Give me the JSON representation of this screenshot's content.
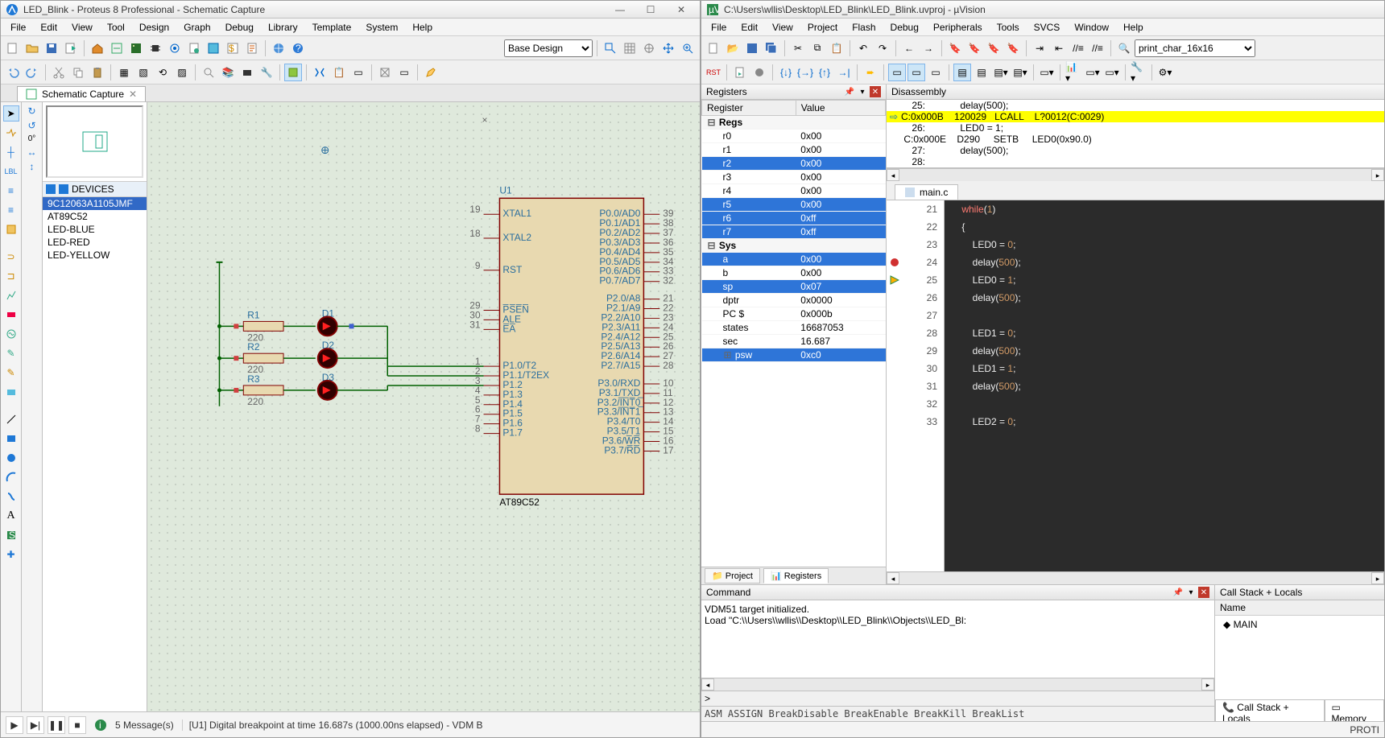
{
  "proteus": {
    "title": "LED_Blink - Proteus 8 Professional - Schematic Capture",
    "menu": [
      "File",
      "Edit",
      "View",
      "Tool",
      "Design",
      "Graph",
      "Debug",
      "Library",
      "Template",
      "System",
      "Help"
    ],
    "designSelector": "Base Design",
    "captureTab": "Schematic Capture",
    "deviceHeader": "DEVICES",
    "deviceList": [
      "9C12063A1105JMF",
      "AT89C52",
      "LED-BLUE",
      "LED-RED",
      "LED-YELLOW"
    ],
    "deviceSelected": 0,
    "statusMessages": "5 Message(s)",
    "statusText": "[U1] Digital breakpoint at time 16.687s (1000.00ns elapsed) - VDM B",
    "rotAngle": "0°",
    "schematic": {
      "u1_ref": "U1",
      "u1_part": "AT89C52",
      "r1": {
        "ref": "R1",
        "val": "220"
      },
      "r2": {
        "ref": "R2",
        "val": "220"
      },
      "r3": {
        "ref": "R3",
        "val": "220"
      },
      "d1": "D1",
      "d2": "D2",
      "d3": "D3",
      "leftPins": [
        {
          "num": "19",
          "name": "XTAL1"
        },
        {
          "num": "18",
          "name": "XTAL2"
        },
        {
          "num": "9",
          "name": "RST"
        },
        {
          "num": "29",
          "name": "P̅S̅E̅N̅"
        },
        {
          "num": "30",
          "name": "ALE"
        },
        {
          "num": "31",
          "name": "E̅A̅"
        },
        {
          "num": "1",
          "name": "P1.0/T2"
        },
        {
          "num": "2",
          "name": "P1.1/T2EX"
        },
        {
          "num": "3",
          "name": "P1.2"
        },
        {
          "num": "4",
          "name": "P1.3"
        },
        {
          "num": "5",
          "name": "P1.4"
        },
        {
          "num": "6",
          "name": "P1.5"
        },
        {
          "num": "7",
          "name": "P1.6"
        },
        {
          "num": "8",
          "name": "P1.7"
        }
      ],
      "rightPins": [
        {
          "num": "39",
          "name": "P0.0/AD0"
        },
        {
          "num": "38",
          "name": "P0.1/AD1"
        },
        {
          "num": "37",
          "name": "P0.2/AD2"
        },
        {
          "num": "36",
          "name": "P0.3/AD3"
        },
        {
          "num": "35",
          "name": "P0.4/AD4"
        },
        {
          "num": "34",
          "name": "P0.5/AD5"
        },
        {
          "num": "33",
          "name": "P0.6/AD6"
        },
        {
          "num": "32",
          "name": "P0.7/AD7"
        },
        {
          "num": "21",
          "name": "P2.0/A8"
        },
        {
          "num": "22",
          "name": "P2.1/A9"
        },
        {
          "num": "23",
          "name": "P2.2/A10"
        },
        {
          "num": "24",
          "name": "P2.3/A11"
        },
        {
          "num": "25",
          "name": "P2.4/A12"
        },
        {
          "num": "26",
          "name": "P2.5/A13"
        },
        {
          "num": "27",
          "name": "P2.6/A14"
        },
        {
          "num": "28",
          "name": "P2.7/A15"
        },
        {
          "num": "10",
          "name": "P3.0/RXD"
        },
        {
          "num": "11",
          "name": "P3.1/TXD"
        },
        {
          "num": "12",
          "name": "P3.2/I̅N̅T̅0̅"
        },
        {
          "num": "13",
          "name": "P3.3/I̅N̅T̅1̅"
        },
        {
          "num": "14",
          "name": "P3.4/T0"
        },
        {
          "num": "15",
          "name": "P3.5/T1"
        },
        {
          "num": "16",
          "name": "P3.6/W̅R̅"
        },
        {
          "num": "17",
          "name": "P3.7/R̅D̅"
        }
      ]
    }
  },
  "uvision": {
    "title": "C:\\Users\\wllis\\Desktop\\LED_Blink\\LED_Blink.uvproj - µVision",
    "menu": [
      "File",
      "Edit",
      "View",
      "Project",
      "Flash",
      "Debug",
      "Peripherals",
      "Tools",
      "SVCS",
      "Window",
      "Help"
    ],
    "configCombo": "print_char_16x16",
    "panels": {
      "registers": "Registers",
      "disassembly": "Disassembly",
      "command": "Command",
      "callstack": "Call Stack + Locals"
    },
    "regHeader": {
      "c1": "Register",
      "c2": "Value"
    },
    "regGroups": [
      "Regs",
      "Sys"
    ],
    "regs": [
      {
        "n": "r0",
        "v": "0x00",
        "hl": false
      },
      {
        "n": "r1",
        "v": "0x00",
        "hl": false
      },
      {
        "n": "r2",
        "v": "0x00",
        "hl": true
      },
      {
        "n": "r3",
        "v": "0x00",
        "hl": false
      },
      {
        "n": "r4",
        "v": "0x00",
        "hl": false
      },
      {
        "n": "r5",
        "v": "0x00",
        "hl": true
      },
      {
        "n": "r6",
        "v": "0xff",
        "hl": true
      },
      {
        "n": "r7",
        "v": "0xff",
        "hl": true
      }
    ],
    "sys": [
      {
        "n": "a",
        "v": "0x00",
        "hl": true
      },
      {
        "n": "b",
        "v": "0x00",
        "hl": false
      },
      {
        "n": "sp",
        "v": "0x07",
        "hl": true
      },
      {
        "n": "dptr",
        "v": "0x0000",
        "hl": false
      },
      {
        "n": "PC  $",
        "v": "0x000b",
        "hl": false
      },
      {
        "n": "states",
        "v": "16687053",
        "hl": false
      },
      {
        "n": "sec",
        "v": "16.687",
        "hl": false
      },
      {
        "n": "psw",
        "v": "0xc0",
        "hl": true,
        "expand": true
      }
    ],
    "bottomTabs": [
      "Project",
      "Registers"
    ],
    "bottomActive": 1,
    "disasm": [
      {
        "cur": false,
        "arrow": "",
        "text": "    25:             delay(500);"
      },
      {
        "cur": true,
        "arrow": "⇨",
        "text": "C:0x000B    120029   LCALL    L?0012(C:0029)"
      },
      {
        "cur": false,
        "arrow": "",
        "text": "    26:             LED0 = 1;"
      },
      {
        "cur": false,
        "arrow": "",
        "text": " C:0x000E    D290     SETB     LED0(0x90.0)"
      },
      {
        "cur": false,
        "arrow": "",
        "text": "    27:             delay(500);"
      },
      {
        "cur": false,
        "arrow": "",
        "text": "    28: "
      }
    ],
    "editorTab": "main.c",
    "code": {
      "start": 21,
      "markers": {
        "24": "bp",
        "25": "pc"
      },
      "lines": [
        {
          "t": "    while(1)",
          "kw": [
            "while"
          ]
        },
        {
          "t": "    {"
        },
        {
          "t": "        LED0 = 0;"
        },
        {
          "t": "        delay(500);"
        },
        {
          "t": "        LED0 = 1;"
        },
        {
          "t": "        delay(500);"
        },
        {
          "t": ""
        },
        {
          "t": "        LED1 = 0;"
        },
        {
          "t": "        delay(500);"
        },
        {
          "t": "        LED1 = 1;"
        },
        {
          "t": "        delay(500);"
        },
        {
          "t": ""
        },
        {
          "t": "        LED2 = 0;"
        }
      ]
    },
    "cmdLines": [
      "VDM51 target initialized.",
      "Load \"C:\\\\Users\\\\wllis\\\\Desktop\\\\LED_Blink\\\\Objects\\\\LED_Bl:"
    ],
    "cmdPrompt": ">",
    "cmdHelp": "ASM ASSIGN BreakDisable BreakEnable BreakKill BreakList",
    "callstack": {
      "col": "Name",
      "rows": [
        "MAIN"
      ]
    },
    "csTabs": [
      "Call Stack + Locals",
      "Memory"
    ],
    "statusRight": "PROTI"
  }
}
